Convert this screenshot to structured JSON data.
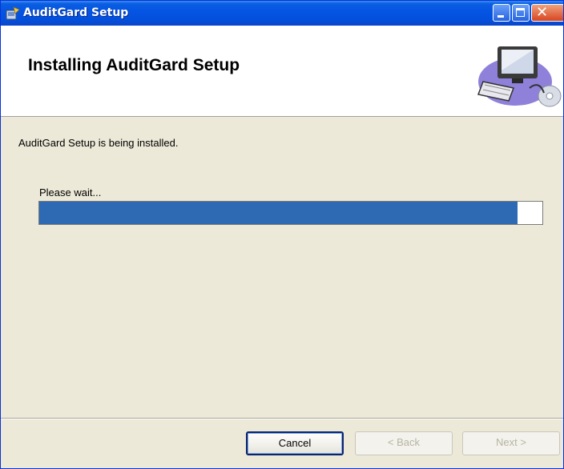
{
  "window": {
    "title": "AuditGard Setup"
  },
  "header": {
    "title": "Installing AuditGard Setup"
  },
  "main": {
    "status_text": "AuditGard Setup is being installed.",
    "wait_label": "Please wait...",
    "progress_fraction": 0.95
  },
  "buttons": {
    "cancel": "Cancel",
    "back": "< Back",
    "next": "Next >"
  },
  "colors": {
    "progress_fill": "#2e6ab3",
    "titlebar": "#0554e3",
    "dialog_bg": "#ece9d8"
  }
}
